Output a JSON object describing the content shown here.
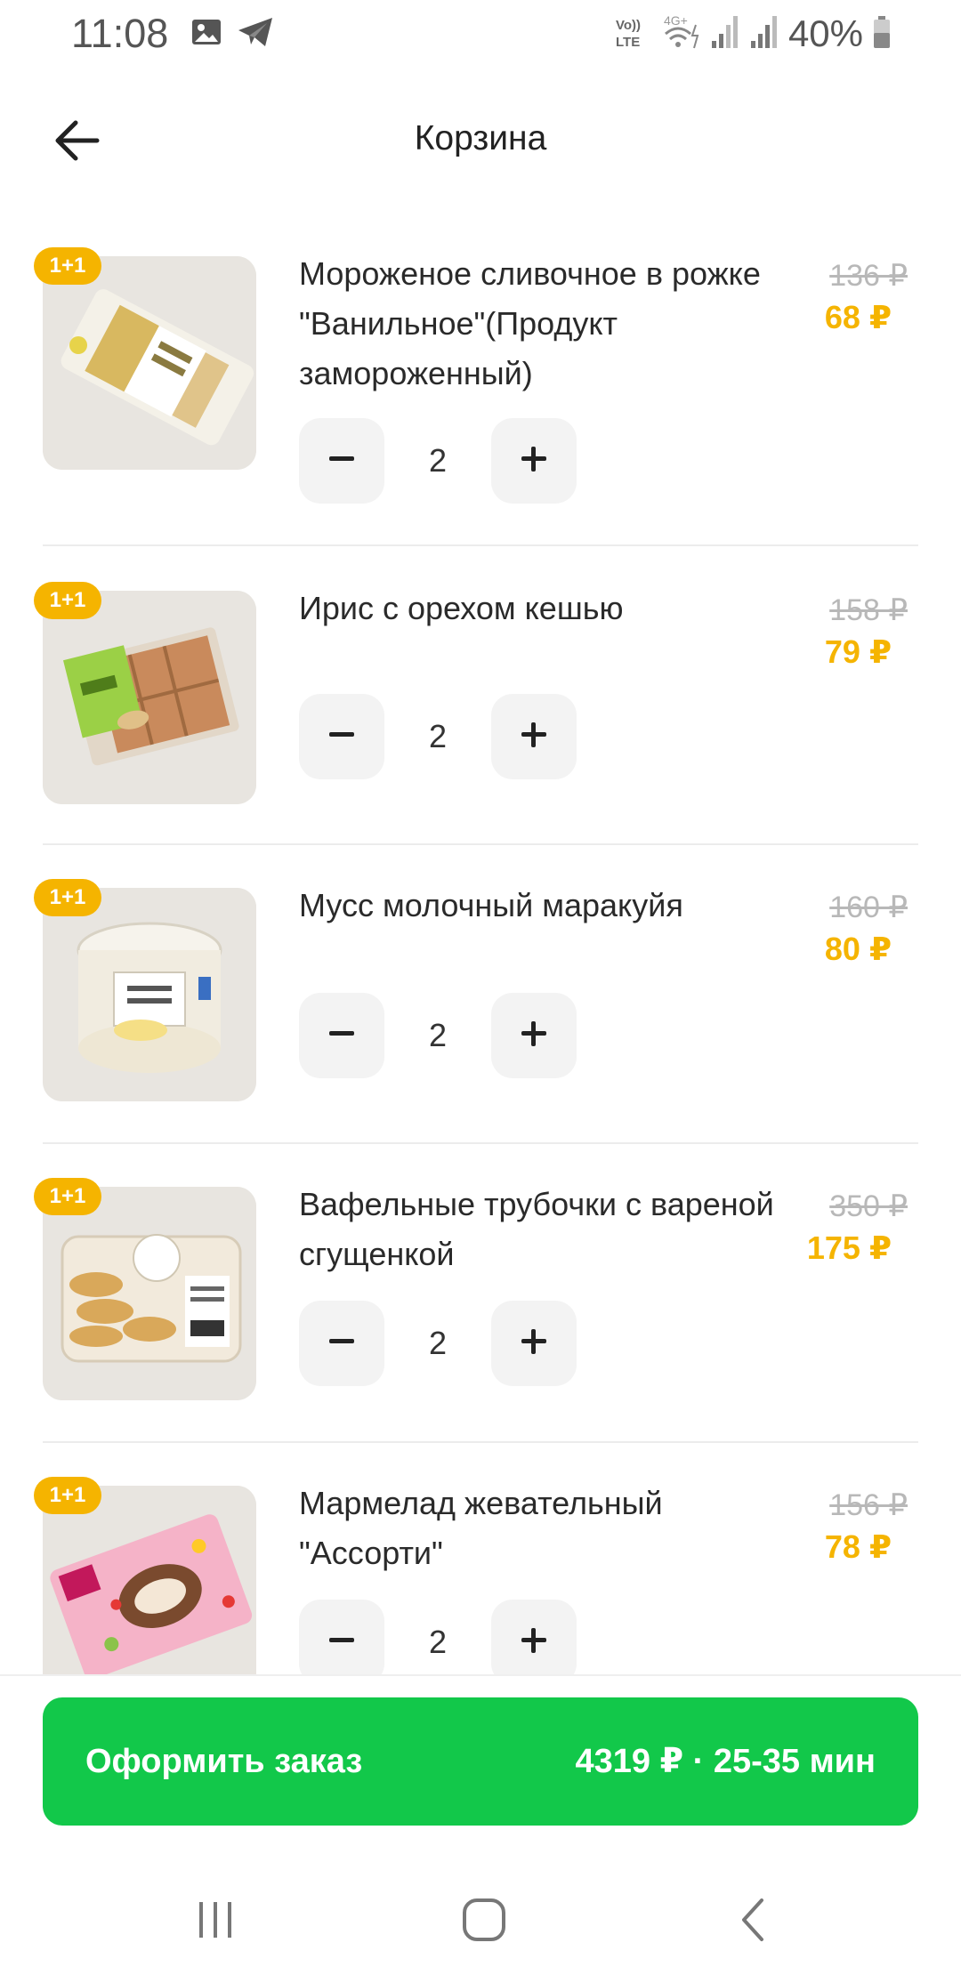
{
  "status_bar": {
    "time": "11:08",
    "battery": "40%"
  },
  "header": {
    "title": "Корзина"
  },
  "colors": {
    "accent_yellow": "#f5b400",
    "checkout_green": "#12c84a"
  },
  "items": [
    {
      "badge": "1+1",
      "name": "Мороженое сливочное в рожке \"Ванильное\"(Продукт замороженный)",
      "price_old": "136 ₽",
      "price_new": "68 ₽",
      "quantity": "2"
    },
    {
      "badge": "1+1",
      "name": "Ирис с орехом кешью",
      "price_old": "158 ₽",
      "price_new": "79 ₽",
      "quantity": "2"
    },
    {
      "badge": "1+1",
      "name": "Мусс молочный маракуйя",
      "price_old": "160 ₽",
      "price_new": "80 ₽",
      "quantity": "2"
    },
    {
      "badge": "1+1",
      "name": "Вафельные трубочки с вареной сгущенкой",
      "price_old": "350 ₽",
      "price_new": "175 ₽",
      "quantity": "2"
    },
    {
      "badge": "1+1",
      "name": "Мармелад жевательный \"Ассорти\"",
      "price_old": "156 ₽",
      "price_new": "78 ₽",
      "quantity": "2"
    }
  ],
  "checkout": {
    "label": "Оформить заказ",
    "summary": "4319 ₽ · 25-35 мин"
  }
}
